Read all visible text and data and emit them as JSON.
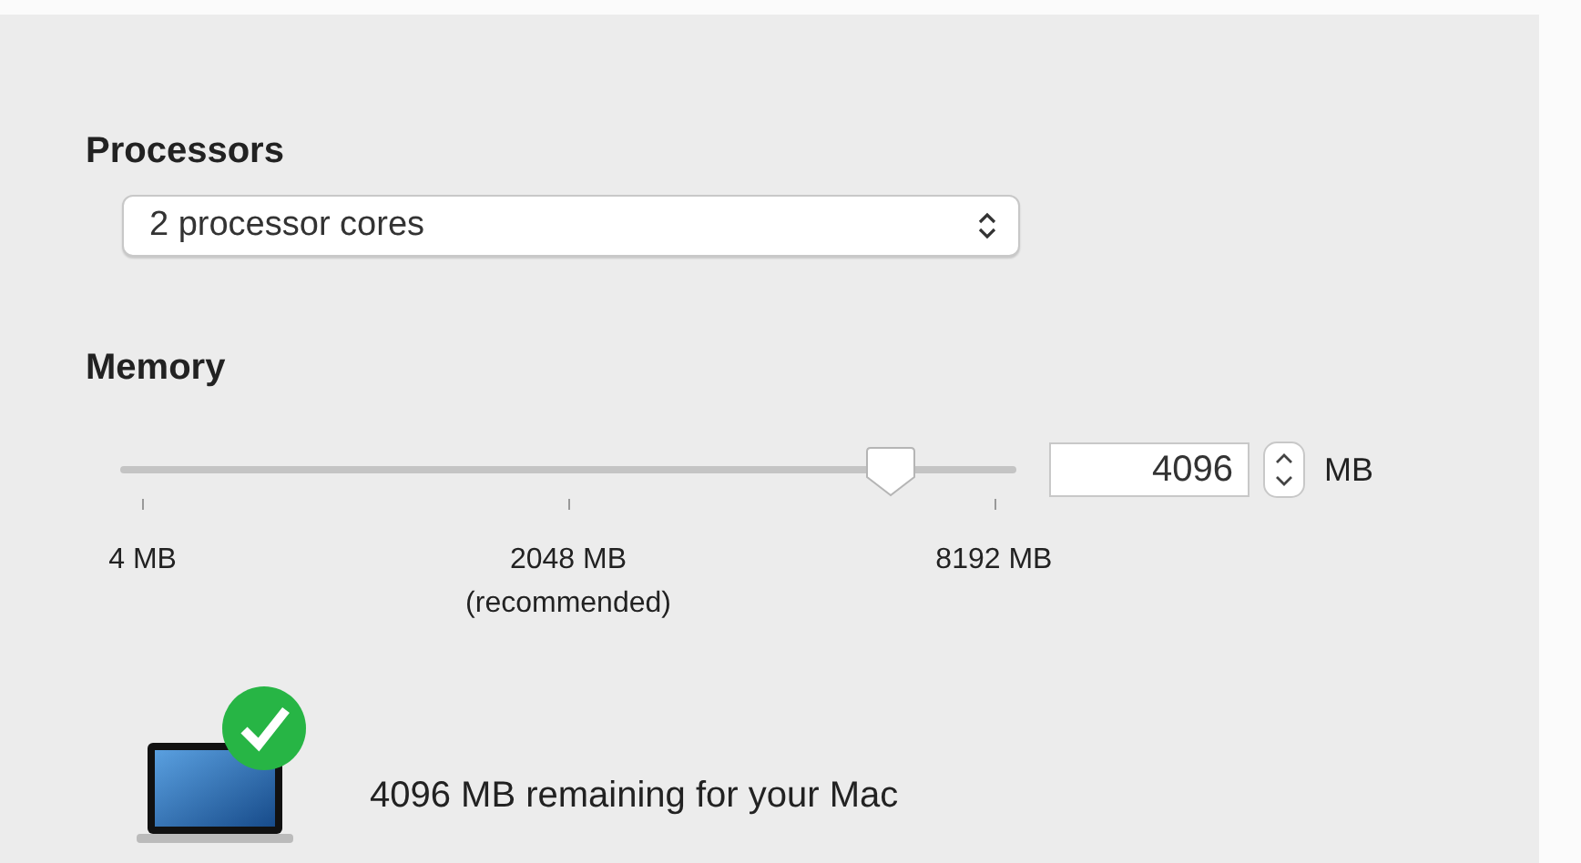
{
  "processors": {
    "heading": "Processors",
    "select": {
      "value": "2 processor cores"
    }
  },
  "memory": {
    "heading": "Memory",
    "slider": {
      "level": 0.86
    },
    "ticks": [
      {
        "label": "4 MB"
      },
      {
        "label": "2048 MB",
        "note": "(recommended)"
      },
      {
        "label": "8192 MB"
      }
    ],
    "field": {
      "value": "4096"
    },
    "unit": "MB"
  },
  "status": {
    "text": "4096 MB remaining for your Mac"
  }
}
